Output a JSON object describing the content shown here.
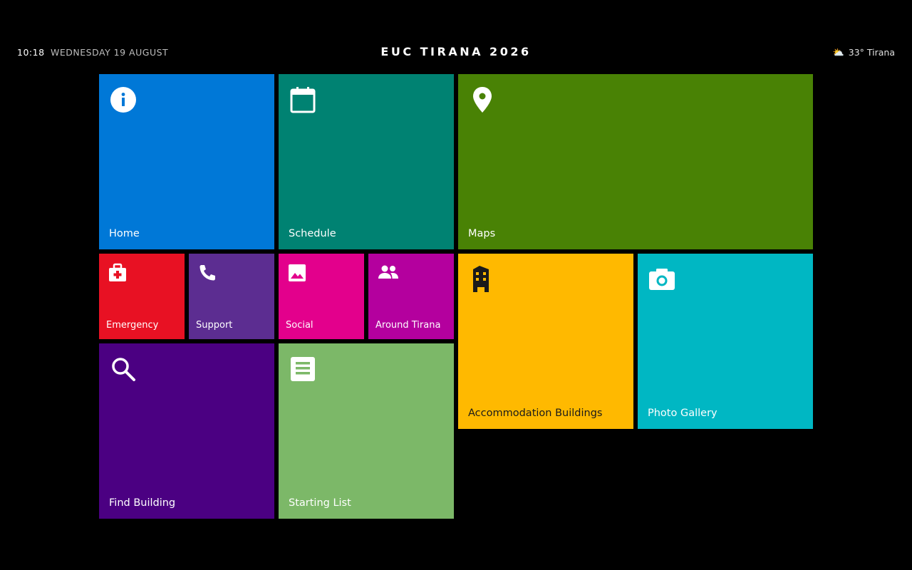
{
  "header": {
    "time": "10:18",
    "date": "WEDNESDAY 19 AUGUST",
    "title": "EUC TIRANA 2026",
    "weather_icon": "⛅",
    "weather_text": "33° Tirana"
  },
  "tiles": {
    "home": {
      "label": "Home",
      "color": "#0078d7",
      "icon": "info-icon"
    },
    "schedule": {
      "label": "Schedule",
      "color": "#008272",
      "icon": "calendar-icon"
    },
    "maps": {
      "label": "Maps",
      "color": "#498205",
      "icon": "map-pin-icon"
    },
    "emergency": {
      "label": "Emergency",
      "color": "#e81123",
      "icon": "medical-kit-icon"
    },
    "support": {
      "label": "Support",
      "color": "#5c2d91",
      "icon": "phone-icon"
    },
    "social": {
      "label": "Social",
      "color": "#e3008c",
      "icon": "image-icon"
    },
    "around": {
      "label": "Around Tirana",
      "color": "#b4009e",
      "icon": "people-icon"
    },
    "accommodation": {
      "label": "Accommodation Buildings",
      "color": "#ffb900",
      "icon": "building-icon"
    },
    "gallery": {
      "label": "Photo Gallery",
      "color": "#00b7c3",
      "icon": "camera-icon"
    },
    "find": {
      "label": "Find Building",
      "color": "#4b0082",
      "icon": "search-icon"
    },
    "starting": {
      "label": "Starting List",
      "color": "#7cb868",
      "icon": "document-icon"
    }
  }
}
